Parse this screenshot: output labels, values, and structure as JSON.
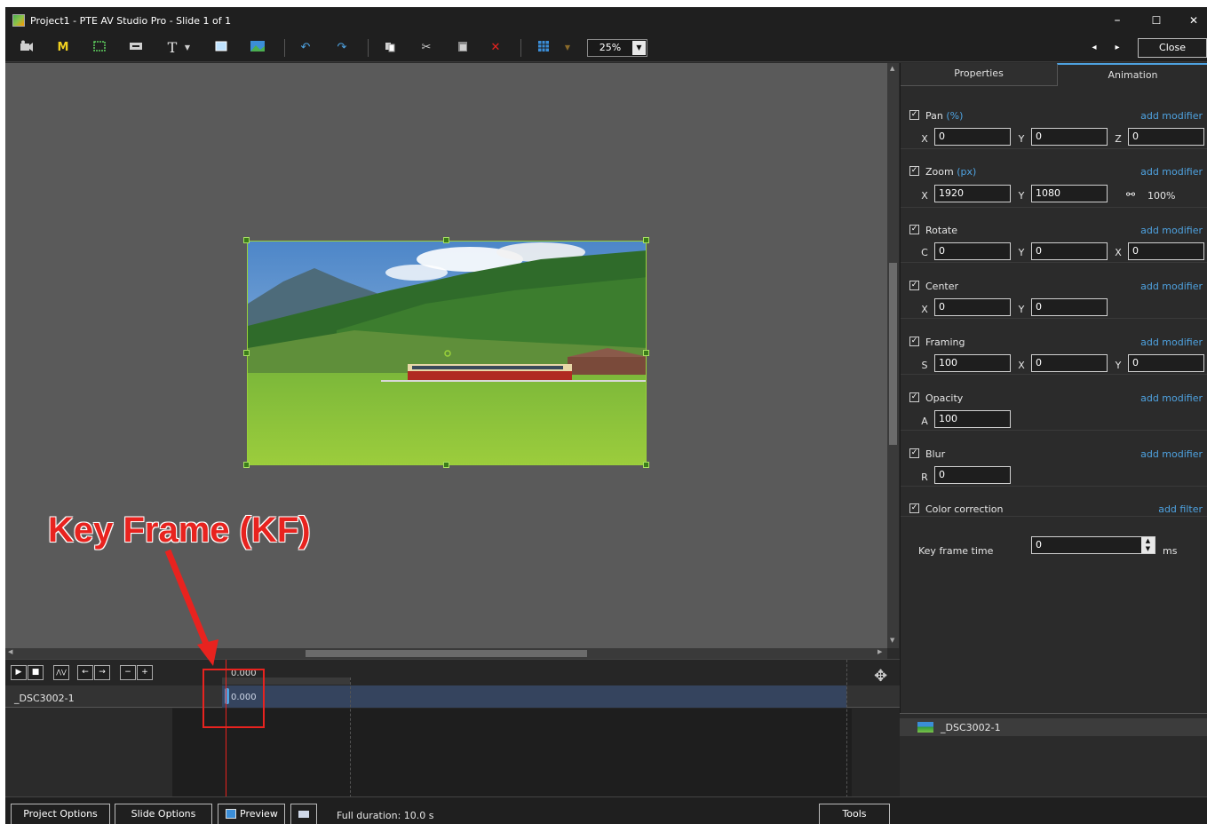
{
  "window": {
    "title": "Project1 - PTE AV Studio Pro - Slide 1 of 1",
    "minimize": "–",
    "maximize": "☐",
    "close": "✕"
  },
  "toolbar": {
    "icons": [
      "camera-icon",
      "m-icon",
      "frame-icon",
      "caption-icon",
      "text-icon",
      "dropdown-icon",
      "rectangle-icon",
      "image-icon",
      "undo-icon",
      "redo-icon",
      "copy-icon",
      "cut-icon",
      "paste-icon",
      "delete-icon",
      "grid-icon",
      "grid-dropdown-icon"
    ],
    "m_label": "M",
    "t_label": "T",
    "zoom_value": "25%",
    "nav_prev": "◂",
    "nav_next": "▸",
    "close_label": "Close"
  },
  "annotation": {
    "label": "Key Frame (KF)"
  },
  "panel": {
    "tabs": [
      "Properties",
      "Animation"
    ],
    "active_tab": "Animation",
    "sections": {
      "pan": {
        "title": "Pan",
        "unit": "(%)",
        "add": "add modifier",
        "fields": [
          {
            "label": "X",
            "value": "0"
          },
          {
            "label": "Y",
            "value": "0"
          },
          {
            "label": "Z",
            "value": "0"
          }
        ]
      },
      "zoom": {
        "title": "Zoom",
        "unit": "(px)",
        "add": "add modifier",
        "fields": [
          {
            "label": "X",
            "value": "1920"
          },
          {
            "label": "Y",
            "value": "1080"
          }
        ],
        "percent": "100%"
      },
      "rotate": {
        "title": "Rotate",
        "add": "add modifier",
        "fields": [
          {
            "label": "C",
            "value": "0"
          },
          {
            "label": "Y",
            "value": "0"
          },
          {
            "label": "X",
            "value": "0"
          }
        ]
      },
      "center": {
        "title": "Center",
        "add": "add modifier",
        "fields": [
          {
            "label": "X",
            "value": "0"
          },
          {
            "label": "Y",
            "value": "0"
          }
        ]
      },
      "framing": {
        "title": "Framing",
        "add": "add modifier",
        "fields": [
          {
            "label": "S",
            "value": "100"
          },
          {
            "label": "X",
            "value": "0"
          },
          {
            "label": "Y",
            "value": "0"
          }
        ]
      },
      "opacity": {
        "title": "Opacity",
        "add": "add modifier",
        "fields": [
          {
            "label": "A",
            "value": "100"
          }
        ]
      },
      "blur": {
        "title": "Blur",
        "add": "add modifier",
        "fields": [
          {
            "label": "R",
            "value": "0"
          }
        ]
      },
      "color": {
        "title": "Color correction",
        "add": "add filter"
      }
    },
    "keyframe_time": {
      "label": "Key frame time",
      "value": "0",
      "unit": "ms"
    },
    "objects": [
      {
        "name": "_DSC3002-1"
      }
    ]
  },
  "timeline": {
    "buttons": [
      "▶",
      "■",
      "⋀⋁",
      "←",
      "→",
      "−",
      "+"
    ],
    "ruler_time": "0.000",
    "track": {
      "name": "_DSC3002-1",
      "keyframe_time": "0.000"
    }
  },
  "statusbar": {
    "project_options": "Project Options",
    "slide_options": "Slide Options",
    "preview": "Preview",
    "full_duration": "Full duration: 10.0 s",
    "tools": "Tools"
  },
  "colors": {
    "accent": "#4ea2e0",
    "annotation": "#e8231f",
    "selection": "#9ad13a"
  }
}
